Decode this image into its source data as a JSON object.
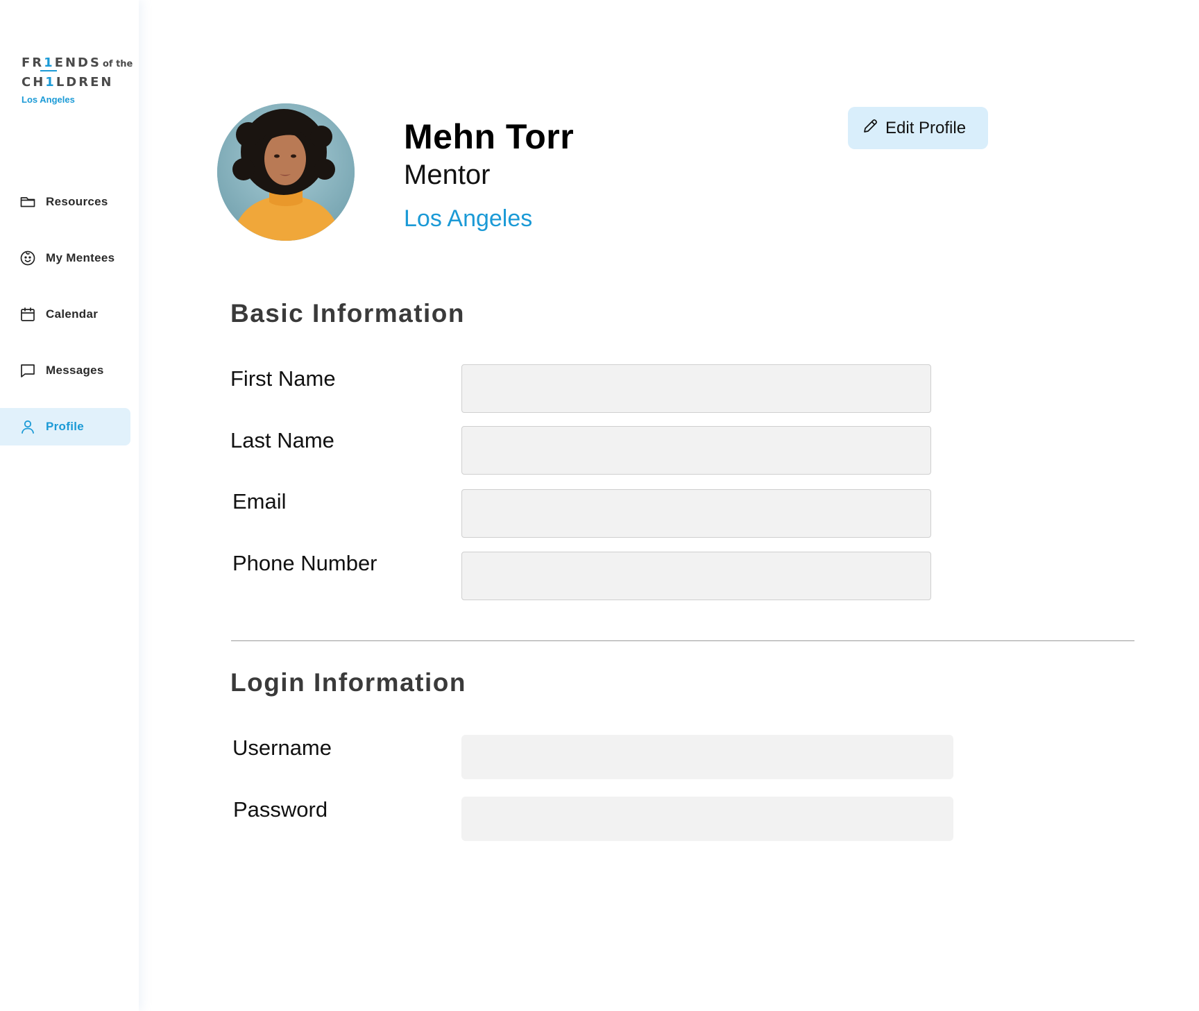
{
  "logo": {
    "line1_a": "FR",
    "line1_one": "1",
    "line1_b": "ENDS",
    "line1_suffix": "of the",
    "line2_a": "CH",
    "line2_one": "1",
    "line2_b": "LDREN",
    "city": "Los Angeles"
  },
  "sidebar": {
    "items": [
      {
        "label": "Resources",
        "icon": "folder-icon"
      },
      {
        "label": "My Mentees",
        "icon": "smiley-icon"
      },
      {
        "label": "Calendar",
        "icon": "calendar-icon"
      },
      {
        "label": "Messages",
        "icon": "message-icon"
      },
      {
        "label": "Profile",
        "icon": "user-icon",
        "active": true
      }
    ]
  },
  "profile": {
    "name": "Mehn Torr",
    "role": "Mentor",
    "location": "Los Angeles",
    "edit_label": "Edit Profile"
  },
  "basic": {
    "title": "Basic Information",
    "first_name_label": "First Name",
    "last_name_label": "Last Name",
    "email_label": "Email",
    "phone_label": "Phone Number"
  },
  "login": {
    "title": "Login Information",
    "username_label": "Username",
    "password_label": "Password"
  },
  "colors": {
    "accent": "#1b9ad6",
    "active_bg": "#e1f1fb",
    "button_bg": "#d9eefb",
    "field_bg": "#f2f2f2"
  }
}
